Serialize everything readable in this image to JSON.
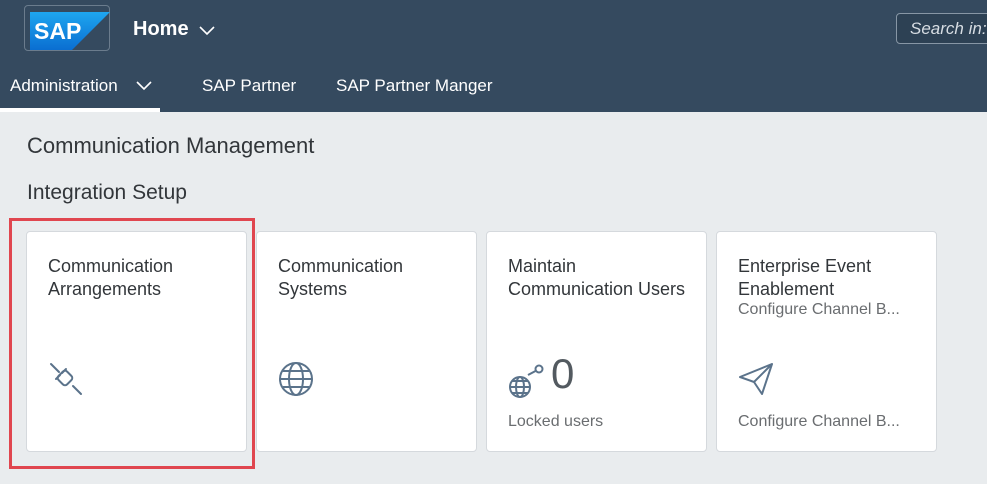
{
  "shell": {
    "logo_text": "SAP",
    "home_label": "Home",
    "search_placeholder": "Search in:"
  },
  "tabs": [
    {
      "label": "Administration",
      "active": true
    },
    {
      "label": "SAP Partner"
    },
    {
      "label": "SAP Partner Manger"
    }
  ],
  "page": {
    "title": "Communication Management",
    "section": "Integration Setup"
  },
  "tiles": [
    {
      "title": "Communication Arrangements",
      "icon": "plug-icon"
    },
    {
      "title": "Communication Systems",
      "icon": "globe-icon"
    },
    {
      "title": "Maintain Communication Users",
      "icon": "globe-key-icon",
      "kpi": "0",
      "footer": "Locked users"
    },
    {
      "title": "Enterprise Event Enablement",
      "subtitle": "Configure Channel B...",
      "icon": "paper-plane-icon",
      "footer": "Configure Channel B..."
    }
  ],
  "colors": {
    "shell": "#354a5f",
    "background": "#e9ecee",
    "highlight": "#e0464f",
    "icon": "#5b738b"
  }
}
